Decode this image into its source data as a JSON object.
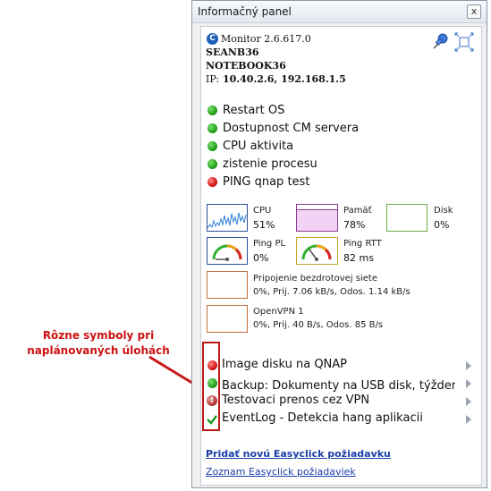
{
  "window": {
    "title": "Informačný panel",
    "close_label": "x"
  },
  "info": {
    "app": "Monitor 2.6.617.0",
    "user": "SEANB36",
    "host": "NOTEBOOK36",
    "ip_label": "IP:",
    "ip_value": "10.40.2.6, 192.168.1.5"
  },
  "status_checks": [
    {
      "label": "Restart OS",
      "state": "green"
    },
    {
      "label": "Dostupnost CM servera",
      "state": "green"
    },
    {
      "label": "CPU aktivita",
      "state": "green"
    },
    {
      "label": "zistenie procesu",
      "state": "green"
    },
    {
      "label": "PING  qnap test",
      "state": "red"
    }
  ],
  "monitors": {
    "cpu": {
      "label": "CPU",
      "value": "51%"
    },
    "memory": {
      "label": "Pamäť",
      "value": "78%",
      "fill_fraction": 0.78
    },
    "disk": {
      "label": "Disk",
      "value": "0%"
    },
    "ping_pl": {
      "label": "Ping PL",
      "value": "0%"
    },
    "ping_rtt": {
      "label": "Ping RTT",
      "value": "82 ms"
    },
    "wifi": {
      "label": "Pripojenie bezdrotovej siete",
      "value": "0%, Prij. 7.06 kB/s, Odos. 1.14 kB/s"
    },
    "vpn": {
      "label": "OpenVPN 1",
      "value": "0%, Prij. 40 B/s, Odos. 85 B/s"
    }
  },
  "tasks": [
    {
      "label": "Image disku na QNAP",
      "state": "red"
    },
    {
      "label": "Backup: Dokumenty na USB disk, týždenne",
      "state": "green"
    },
    {
      "label": "Testovaci prenos cez VPN",
      "state": "warning"
    },
    {
      "label": "EventLog - Detekcia hang aplikacii",
      "state": "check"
    }
  ],
  "links": {
    "add": "Pridať novú Easyclick požiadavku",
    "list": "Zoznam Easyclick požiadaviek"
  },
  "annotation": {
    "text": "Rôzne symboly pri naplánovaných úlohách",
    "color": "#cc1111"
  }
}
